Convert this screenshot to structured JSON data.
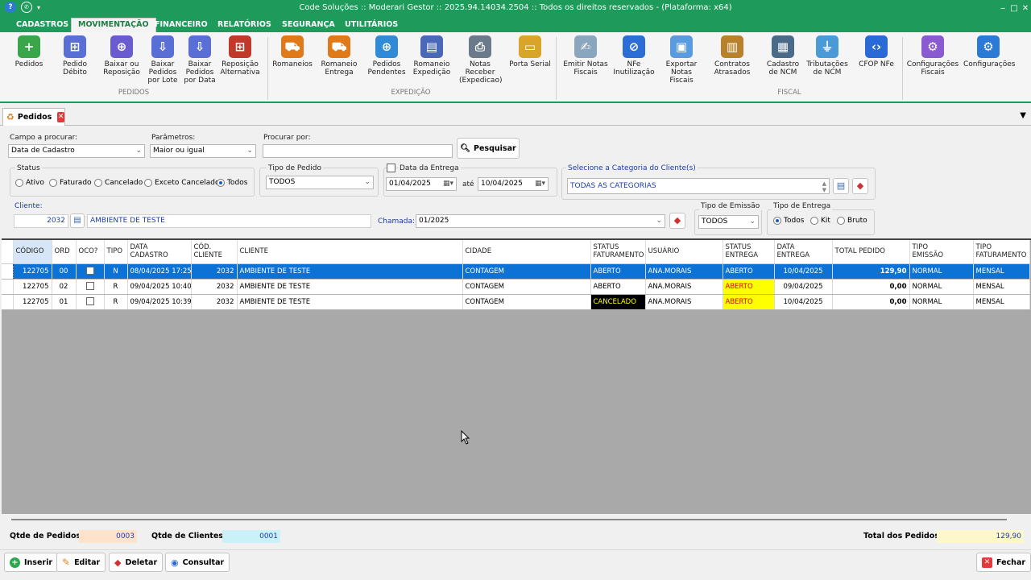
{
  "window": {
    "title": "Code Soluções :: Moderari Gestor :: 2025.94.14034.2504 :: Todos os direitos reservados - (Plataforma: x64)",
    "controls": [
      "‒",
      "□",
      "✕"
    ]
  },
  "menu_tabs": [
    {
      "label": "CADASTROS",
      "active": false
    },
    {
      "label": "MOVIMENTAÇÃO",
      "active": true
    },
    {
      "label": "FINANCEIRO",
      "active": false
    },
    {
      "label": "RELATÓRIOS",
      "active": false
    },
    {
      "label": "SEGURANÇA",
      "active": false
    },
    {
      "label": "UTILITÁRIOS",
      "active": false
    }
  ],
  "ribbon": {
    "buttons": [
      {
        "label": "Pedidos",
        "icon": "add-order-icon",
        "color": "#3aa64a"
      },
      {
        "label": "Pedido\nDébito",
        "icon": "basket-icon",
        "color": "#5a6fd6"
      },
      {
        "label": "Baixar ou\nReposição",
        "icon": "basket-plus-icon",
        "color": "#6b5bd0"
      },
      {
        "label": "Baixar\nPedidos\npor Lote",
        "icon": "basket-down-icon",
        "color": "#5a6fd6"
      },
      {
        "label": "Baixar\nPedidos\npor Data",
        "icon": "basket-down-icon",
        "color": "#5a6fd6"
      },
      {
        "label": "Reposição\nAlternativa",
        "icon": "basket-red-icon",
        "color": "#c0392b"
      },
      {
        "label": "Romaneios",
        "icon": "truck-icon",
        "color": "#e07a18"
      },
      {
        "label": "Romaneio\nEntrega",
        "icon": "truck-icon",
        "color": "#e07a18"
      },
      {
        "label": "Pedidos\nPendentes",
        "icon": "cart-icon",
        "color": "#2f8ad8"
      },
      {
        "label": "Romaneio\nExpedição",
        "icon": "clipboard-icon",
        "color": "#4a68b8"
      },
      {
        "label": "Notas\nReceber\n(Expedicao)",
        "icon": "printer-icon",
        "color": "#6a7a8a"
      },
      {
        "label": "Porta Serial",
        "icon": "serial-port-icon",
        "color": "#d9a528"
      },
      {
        "label": "Emitir Notas\nFiscais",
        "icon": "sign-icon",
        "color": "#8aa6bf"
      },
      {
        "label": "NFe\nInutilização",
        "icon": "nfe-icon",
        "color": "#2b6fd6"
      },
      {
        "label": "Exportar\nNotas\nFiscais",
        "icon": "zip-icon",
        "color": "#5a9adf"
      },
      {
        "label": "Contratos\nAtrasados",
        "icon": "contract-icon",
        "color": "#b9822a"
      },
      {
        "label": "Cadastro\nde NCM",
        "icon": "monitor-icon",
        "color": "#4a6a8a"
      },
      {
        "label": "Tributações\nde NCM",
        "icon": "funnel-icon",
        "color": "#4a9ad8"
      },
      {
        "label": "CFOP NFe",
        "icon": "code-doc-icon",
        "color": "#2a6ad6"
      },
      {
        "label": "Configurações\nFiscais",
        "icon": "gears-icon",
        "color": "#8a5ad0"
      },
      {
        "label": "Configurações",
        "icon": "gear-icon",
        "color": "#2a7ad6"
      }
    ],
    "groups": [
      "PEDIDOS",
      "EXPEDIÇÃO",
      "FISCAL"
    ]
  },
  "doc_tab": {
    "label": "Pedidos"
  },
  "filters": {
    "campo_label": "Campo a procurar:",
    "campo_value": "Data de Cadastro",
    "parametros_label": "Parâmetros:",
    "parametros_value": "Maior ou igual",
    "procurar_label": "Procurar por:",
    "procurar_value": "",
    "pesquisar_label": "Pesquisar",
    "status_label": "Status",
    "status_options": [
      "Ativo",
      "Faturado",
      "Cancelado",
      "Exceto Cancelado",
      "Todos"
    ],
    "status_selected": "Todos",
    "tipo_pedido_label": "Tipo de Pedido",
    "tipo_pedido_value": "TODOS",
    "data_entrega_label": "Data da Entrega",
    "data_from": "01/04/2025",
    "ate_label": "até",
    "data_to": "10/04/2025",
    "categoria_label": "Selecione a Categoria do Cliente(s)",
    "categoria_value": "TODAS AS CATEGORIAS",
    "cliente_label": "Cliente:",
    "cliente_code": "2032",
    "cliente_name": "AMBIENTE DE TESTE",
    "chamada_label": "Chamada:",
    "chamada_value": "01/2025",
    "tipo_emissao_label": "Tipo de Emissão",
    "tipo_emissao_value": "TODOS",
    "tipo_entrega_label": "Tipo de Entrega",
    "tipo_entrega_options": [
      "Todos",
      "Kit",
      "Bruto"
    ],
    "tipo_entrega_selected": "Todos"
  },
  "table": {
    "columns": [
      "CÓDIGO",
      "ORD",
      "OCO?",
      "TIPO",
      "DATA\nCADASTRO",
      "CÓD.\nCLIENTE",
      "CLIENTE",
      "CIDADE",
      "STATUS\nFATURAMENTO",
      "USUÁRIO",
      "STATUS\nENTREGA",
      "DATA\nENTREGA",
      "TOTAL PEDIDO",
      "TIPO\nEMISSÃO",
      "TIPO\nFATURAMENTO"
    ],
    "rows": [
      {
        "codigo": "122705",
        "ord": "00",
        "tipo": "N",
        "data_cadastro": "08/04/2025 17:25",
        "cod_cliente": "2032",
        "cliente": "AMBIENTE DE TESTE",
        "cidade": "CONTAGEM",
        "status_faturamento": "ABERTO",
        "usuario": "ANA.MORAIS",
        "status_entrega": "ABERTO",
        "data_entrega": "10/04/2025",
        "total": "129,90",
        "tipo_emissao": "NORMAL",
        "tipo_faturamento": "MENSAL",
        "selected": true
      },
      {
        "codigo": "122705",
        "ord": "02",
        "tipo": "R",
        "data_cadastro": "09/04/2025 10:40",
        "cod_cliente": "2032",
        "cliente": "AMBIENTE DE TESTE",
        "cidade": "CONTAGEM",
        "status_faturamento": "ABERTO",
        "usuario": "ANA.MORAIS",
        "status_entrega": "ABERTO",
        "data_entrega": "09/04/2025",
        "total": "0,00",
        "tipo_emissao": "NORMAL",
        "tipo_faturamento": "MENSAL",
        "selected": false
      },
      {
        "codigo": "122705",
        "ord": "01",
        "tipo": "R",
        "data_cadastro": "09/04/2025 10:39",
        "cod_cliente": "2032",
        "cliente": "AMBIENTE DE TESTE",
        "cidade": "CONTAGEM",
        "status_faturamento": "CANCELADO",
        "usuario": "ANA.MORAIS",
        "status_entrega": "ABERTO",
        "data_entrega": "10/04/2025",
        "total": "0,00",
        "tipo_emissao": "NORMAL",
        "tipo_faturamento": "MENSAL",
        "selected": false
      }
    ]
  },
  "footer": {
    "qtde_pedidos_label": "Qtde de Pedidos:",
    "qtde_pedidos_value": "0003",
    "qtde_clientes_label": "Qtde de Clientes:",
    "qtde_clientes_value": "0001",
    "total_label": "Total dos Pedidos:",
    "total_value": "129,90"
  },
  "actions": {
    "inserir": "Inserir",
    "editar": "Editar",
    "deletar": "Deletar",
    "consultar": "Consultar",
    "fechar": "Fechar"
  },
  "colors": {
    "brand_green": "#1e9a5a",
    "selection_blue": "#0d72d6",
    "status_open_yellow": "#ffff00",
    "status_open_text": "#e00000",
    "cancelado_bg": "#000000",
    "cancelado_text": "#ffff00"
  }
}
